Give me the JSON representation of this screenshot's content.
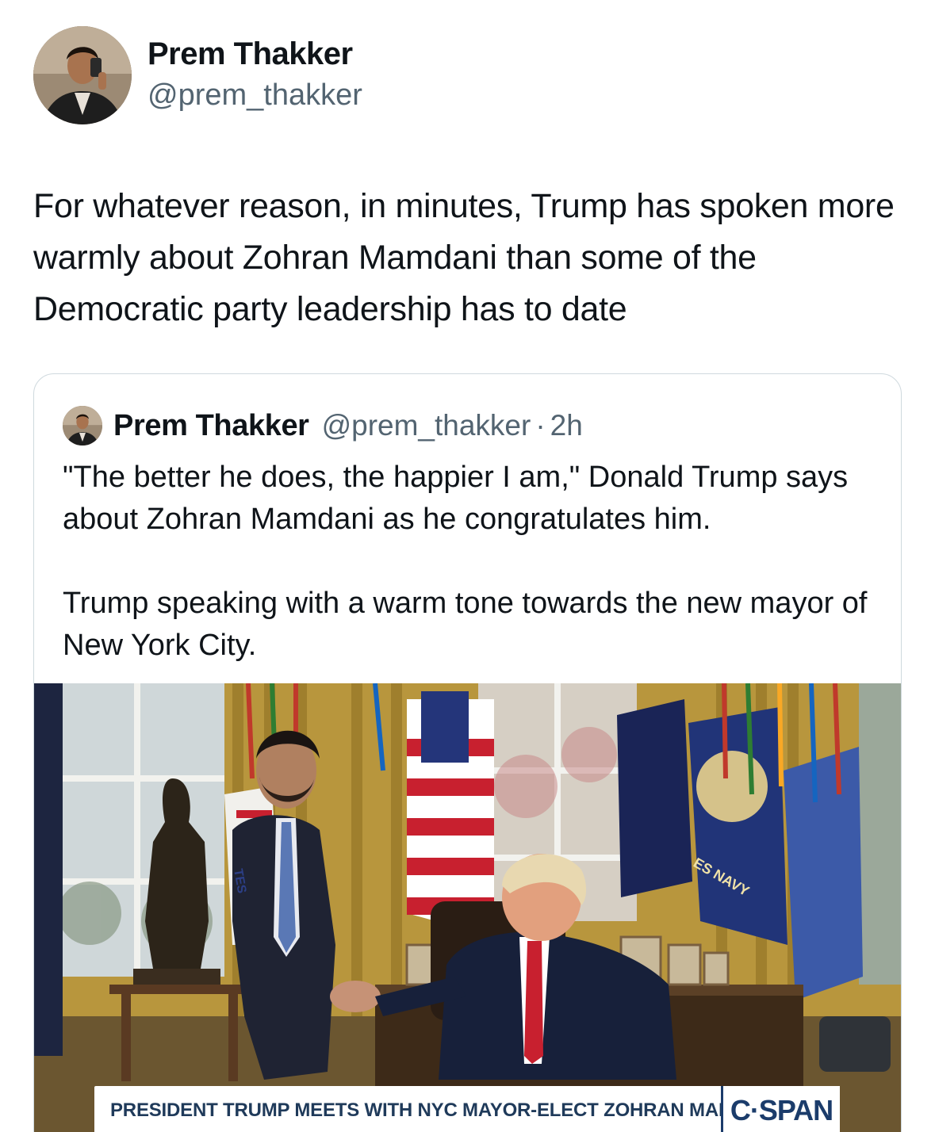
{
  "tweet": {
    "author": {
      "display_name": "Prem Thakker",
      "handle": "@prem_thakker",
      "avatar_icon": "profile-photo-icon"
    },
    "text": "For whatever reason, in minutes, Trump has spoken more warmly about Zohran Mamdani than some of the Democratic party leadership has to date"
  },
  "quoted_tweet": {
    "author": {
      "display_name": "Prem Thakker",
      "handle": "@prem_thakker",
      "separator": "·",
      "time": "2h"
    },
    "paragraphs": [
      "\"The better he does, the happier I am,\" Donald Trump says about Zohran Mamdani as he congratulates him.",
      "Trump speaking with a warm tone towards the new mayor of New York City."
    ],
    "media": {
      "caption": "PRESIDENT TRUMP MEETS WITH NYC MAYOR-ELECT ZOHRAN MAMDANI",
      "network_logo": "C·SPAN",
      "flag_text": "ES NAVY",
      "flag_text_left": "TES"
    }
  },
  "colors": {
    "text_primary": "#0f1419",
    "text_secondary": "#536471",
    "card_border": "#cfd9de",
    "cspan_blue": "#1b3c6b"
  }
}
